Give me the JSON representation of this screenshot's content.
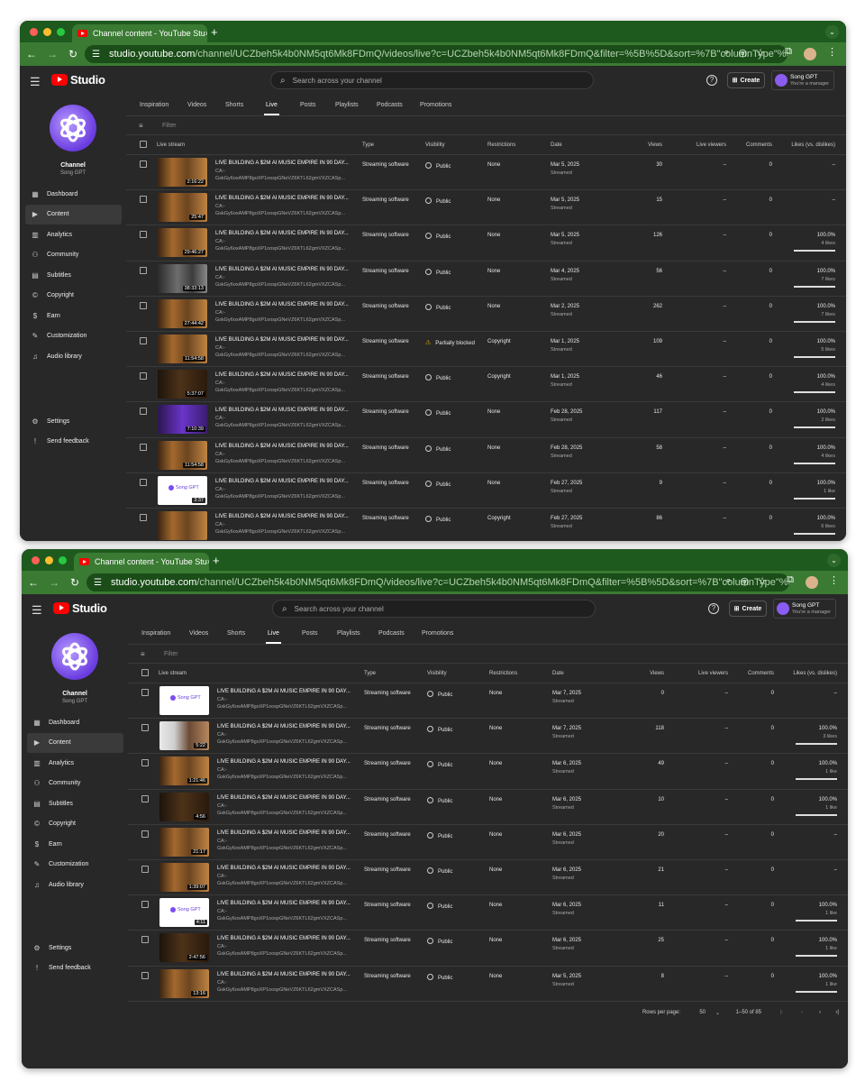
{
  "browser": {
    "tab_title": "Channel content - YouTube Stu",
    "tab_close": "×",
    "new_tab": "+",
    "url_host": "studio.youtube.com",
    "url_path": "/channel/UCZbeh5k4b0NM5qt6Mk8FDmQ/videos/live?c=UCZbeh5k4b0NM5qt6Mk8FDmQ&filter=%5B%5D&sort=%7B\"columnType\"%3A\"..."
  },
  "studio": {
    "logo_text": "Studio",
    "search_placeholder": "Search across your channel",
    "create_label": "Create",
    "account_name": "Song GPT",
    "account_role": "You're a manager"
  },
  "sidebar": {
    "channel_label": "Channel",
    "channel_name": "Song GPT",
    "items": [
      {
        "label": "Dashboard",
        "icon": "dashboard-icon",
        "glyph": "▦"
      },
      {
        "label": "Content",
        "icon": "content-icon",
        "glyph": "▶"
      },
      {
        "label": "Analytics",
        "icon": "analytics-icon",
        "glyph": "▥"
      },
      {
        "label": "Community",
        "icon": "community-icon",
        "glyph": "⚇"
      },
      {
        "label": "Subtitles",
        "icon": "subtitles-icon",
        "glyph": "▤"
      },
      {
        "label": "Copyright",
        "icon": "copyright-icon",
        "glyph": "©"
      },
      {
        "label": "Earn",
        "icon": "earn-icon",
        "glyph": "$"
      },
      {
        "label": "Customization",
        "icon": "customization-icon",
        "glyph": "✎"
      },
      {
        "label": "Audio library",
        "icon": "audio-library-icon",
        "glyph": "♫"
      }
    ],
    "bottom": [
      {
        "label": "Settings",
        "icon": "settings-icon",
        "glyph": "⚙"
      },
      {
        "label": "Send feedback",
        "icon": "feedback-icon",
        "glyph": "!"
      }
    ]
  },
  "content_tabs": [
    "Inspiration",
    "Videos",
    "Shorts",
    "Live",
    "Posts",
    "Playlists",
    "Podcasts",
    "Promotions"
  ],
  "active_tab": "Live",
  "filter_label": "Filter",
  "columns": [
    "Live stream",
    "Type",
    "Visibility",
    "Restrictions",
    "Date",
    "Views",
    "Live viewers",
    "Comments",
    "Likes (vs. dislikes)"
  ],
  "video_title": "LIVE BUILDING A $2M AI MUSIC EMPIRE IN 90 DAY...",
  "description_line1": "CA:-",
  "description_line2a": "GskGy6oxAMP8goXP1oospGNeVZ6KTL62gmVXZCASp...",
  "description_line2b": "GskGy6oxAMP8goXP1oospGNeVZ6KTL62gmVXZCASp...",
  "streamed_label": "Streamed",
  "window1_rows": [
    {
      "duration": "2:16:22",
      "type": "Streaming software",
      "visibility": "Public",
      "restrictions": "None",
      "date": "Mar 5, 2025",
      "views": "30",
      "live_viewers": "–",
      "comments": "0",
      "likes_pct": "–",
      "likes_count": "",
      "likes_fraction": null,
      "thumb": "orange"
    },
    {
      "duration": "25:47",
      "type": "Streaming software",
      "visibility": "Public",
      "restrictions": "None",
      "date": "Mar 5, 2025",
      "views": "15",
      "live_viewers": "–",
      "comments": "0",
      "likes_pct": "–",
      "likes_count": "",
      "likes_fraction": null,
      "thumb": "orange"
    },
    {
      "duration": "29:46:27",
      "type": "Streaming software",
      "visibility": "Public",
      "restrictions": "None",
      "date": "Mar 5, 2025",
      "views": "126",
      "live_viewers": "–",
      "comments": "0",
      "likes_pct": "100.0%",
      "likes_count": "4 likes",
      "likes_fraction": 1,
      "thumb": "orange"
    },
    {
      "duration": "38:33:13",
      "type": "Streaming software",
      "visibility": "Public",
      "restrictions": "None",
      "date": "Mar 4, 2025",
      "views": "56",
      "live_viewers": "–",
      "comments": "0",
      "likes_pct": "100.0%",
      "likes_count": "7 likes",
      "likes_fraction": 1,
      "thumb": "gray"
    },
    {
      "duration": "27:44:42",
      "type": "Streaming software",
      "visibility": "Public",
      "restrictions": "None",
      "date": "Mar 2, 2025",
      "views": "262",
      "live_viewers": "–",
      "comments": "0",
      "likes_pct": "100.0%",
      "likes_count": "7 likes",
      "likes_fraction": 1,
      "thumb": "orange"
    },
    {
      "duration": "11:54:58",
      "type": "Streaming software",
      "visibility": "Partially blocked",
      "restrictions": "Copyright",
      "date": "Mar 1, 2025",
      "views": "109",
      "live_viewers": "–",
      "comments": "0",
      "likes_pct": "100.0%",
      "likes_count": "5 likes",
      "likes_fraction": 1,
      "thumb": "orange",
      "warning": true
    },
    {
      "duration": "5:37:07",
      "type": "Streaming software",
      "visibility": "Public",
      "restrictions": "Copyright",
      "date": "Mar 1, 2025",
      "views": "46",
      "live_viewers": "–",
      "comments": "0",
      "likes_pct": "100.0%",
      "likes_count": "4 likes",
      "likes_fraction": 1,
      "thumb": "dark"
    },
    {
      "duration": "7:10:39",
      "type": "Streaming software",
      "visibility": "Public",
      "restrictions": "None",
      "date": "Feb 28, 2025",
      "views": "117",
      "live_viewers": "–",
      "comments": "0",
      "likes_pct": "100.0%",
      "likes_count": "2 likes",
      "likes_fraction": 1,
      "thumb": "purple"
    },
    {
      "duration": "11:54:58",
      "type": "Streaming software",
      "visibility": "Public",
      "restrictions": "None",
      "date": "Feb 28, 2025",
      "views": "58",
      "live_viewers": "–",
      "comments": "0",
      "likes_pct": "100.0%",
      "likes_count": "4 likes",
      "likes_fraction": 1,
      "thumb": "orange"
    },
    {
      "duration": "3:37",
      "type": "Streaming software",
      "visibility": "Public",
      "restrictions": "None",
      "date": "Feb 27, 2025",
      "views": "9",
      "live_viewers": "–",
      "comments": "0",
      "likes_pct": "100.0%",
      "likes_count": "1 like",
      "likes_fraction": 1,
      "thumb": "logo"
    },
    {
      "duration": "",
      "type": "Streaming software",
      "visibility": "Public",
      "restrictions": "Copyright",
      "date": "Feb 27, 2025",
      "views": "86",
      "live_viewers": "–",
      "comments": "0",
      "likes_pct": "100.0%",
      "likes_count": "6 likes",
      "likes_fraction": 1,
      "thumb": "orange"
    }
  ],
  "window2_rows": [
    {
      "duration": "",
      "type": "Streaming software",
      "visibility": "Public",
      "restrictions": "None",
      "date": "Mar 7, 2025",
      "views": "0",
      "live_viewers": "–",
      "comments": "0",
      "likes_pct": "–",
      "likes_count": "",
      "likes_fraction": null,
      "thumb": "logo"
    },
    {
      "duration": "5:22",
      "type": "Streaming software",
      "visibility": "Public",
      "restrictions": "None",
      "date": "Mar 7, 2025",
      "views": "118",
      "live_viewers": "–",
      "comments": "0",
      "likes_pct": "100.0%",
      "likes_count": "3 likes",
      "likes_fraction": 1,
      "thumb": "face"
    },
    {
      "duration": "1:21:46",
      "type": "Streaming software",
      "visibility": "Public",
      "restrictions": "None",
      "date": "Mar 6, 2025",
      "views": "49",
      "live_viewers": "–",
      "comments": "0",
      "likes_pct": "100.0%",
      "likes_count": "1 like",
      "likes_fraction": 1,
      "thumb": "orange"
    },
    {
      "duration": "4:56",
      "type": "Streaming software",
      "visibility": "Public",
      "restrictions": "None",
      "date": "Mar 6, 2025",
      "views": "10",
      "live_viewers": "–",
      "comments": "0",
      "likes_pct": "100.0%",
      "likes_count": "1 like",
      "likes_fraction": 1,
      "thumb": "dark"
    },
    {
      "duration": "21:17",
      "type": "Streaming software",
      "visibility": "Public",
      "restrictions": "None",
      "date": "Mar 6, 2025",
      "views": "20",
      "live_viewers": "–",
      "comments": "0",
      "likes_pct": "–",
      "likes_count": "",
      "likes_fraction": null,
      "thumb": "orange"
    },
    {
      "duration": "1:39:07",
      "type": "Streaming software",
      "visibility": "Public",
      "restrictions": "None",
      "date": "Mar 6, 2025",
      "views": "21",
      "live_viewers": "–",
      "comments": "0",
      "likes_pct": "–",
      "likes_count": "",
      "likes_fraction": null,
      "thumb": "orange"
    },
    {
      "duration": "4:11",
      "type": "Streaming software",
      "visibility": "Public",
      "restrictions": "None",
      "date": "Mar 6, 2025",
      "views": "11",
      "live_viewers": "–",
      "comments": "0",
      "likes_pct": "100.0%",
      "likes_count": "1 like",
      "likes_fraction": 1,
      "thumb": "logo"
    },
    {
      "duration": "2:47:56",
      "type": "Streaming software",
      "visibility": "Public",
      "restrictions": "None",
      "date": "Mar 6, 2025",
      "views": "25",
      "live_viewers": "–",
      "comments": "0",
      "likes_pct": "100.0%",
      "likes_count": "1 like",
      "likes_fraction": 1,
      "thumb": "dark"
    },
    {
      "duration": "13:16",
      "type": "Streaming software",
      "visibility": "Public",
      "restrictions": "None",
      "date": "Mar 5, 2025",
      "views": "8",
      "live_viewers": "–",
      "comments": "0",
      "likes_pct": "100.0%",
      "likes_count": "1 like",
      "likes_fraction": 1,
      "thumb": "orange"
    }
  ],
  "logo_thumb_text": "Song GPT",
  "pagination": {
    "rows_per_page_label": "Rows per page:",
    "rows_per_page": "50",
    "range": "1–50 of 85"
  },
  "colors": {
    "frame_green": "#1e5a1e",
    "toolbar_green": "#3a7a33",
    "studio_bg": "#282828",
    "warning": "#f0b400",
    "yt_red": "#ff0000"
  }
}
